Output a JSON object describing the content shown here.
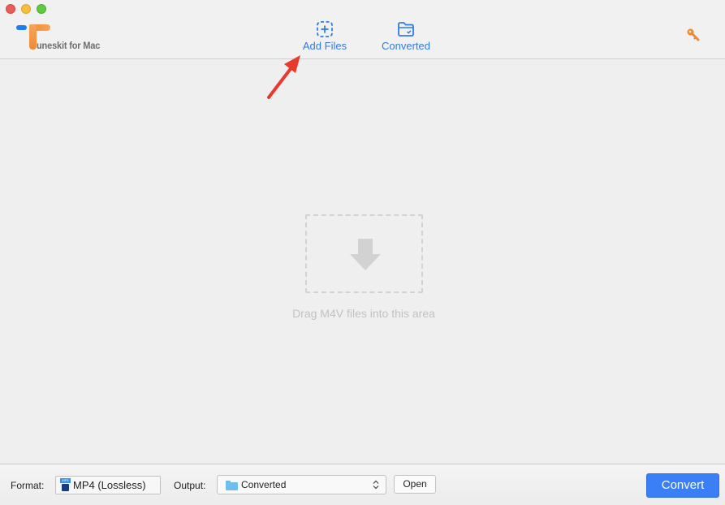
{
  "app": {
    "logo_text": "uneskit for Mac",
    "brand_colors": {
      "orange": "#f08a2e",
      "blue": "#1e7cf2"
    }
  },
  "toolbar": {
    "add_files_label": "Add Files",
    "converted_label": "Converted",
    "icons": {
      "add_files": "dashed-plus-square-icon",
      "converted": "folder-check-icon",
      "register": "key-icon"
    },
    "accent_color": "#2f7be8",
    "key_color": "#f08a2e"
  },
  "annotation": {
    "type": "red-arrow",
    "points_to": "Add Files",
    "color": "#e8392e"
  },
  "main": {
    "drop_hint": "Drag M4V files into this area",
    "drop_icon": "download-arrow-icon"
  },
  "bottom": {
    "format_label": "Format:",
    "format_value": "MP4 (Lossless)",
    "format_icon_text": "MP4",
    "output_label": "Output:",
    "output_value": "Converted",
    "open_label": "Open",
    "convert_label": "Convert",
    "convert_color": "#3a7ff6"
  }
}
